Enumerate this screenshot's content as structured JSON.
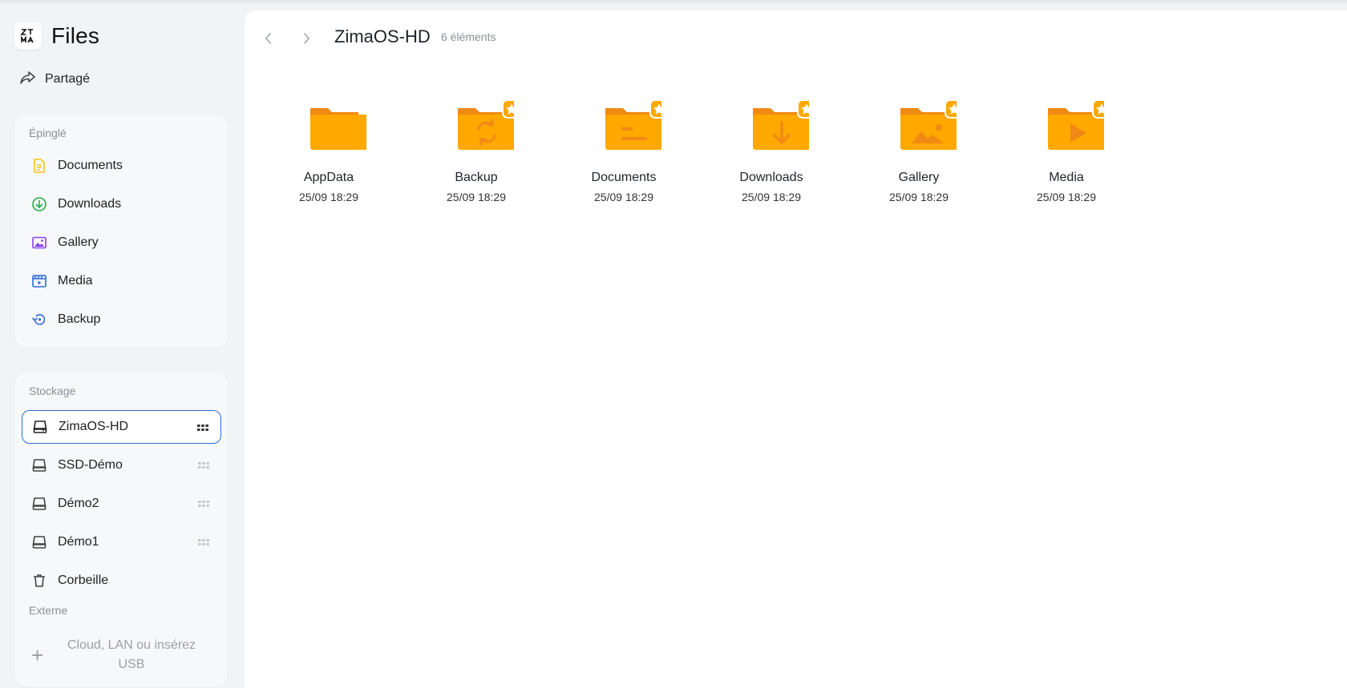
{
  "app": {
    "title": "Files",
    "logo_text": "ZT MA"
  },
  "sidebar": {
    "shared_label": "Partagé",
    "pinned_title": "Épinglé",
    "pinned": [
      {
        "label": "Documents",
        "icon": "document-icon",
        "color": "#f5c518"
      },
      {
        "label": "Downloads",
        "icon": "download-circle-icon",
        "color": "#22b04b"
      },
      {
        "label": "Gallery",
        "icon": "image-icon",
        "color": "#8a3ffc"
      },
      {
        "label": "Media",
        "icon": "video-clapper-icon",
        "color": "#2e6bdc"
      },
      {
        "label": "Backup",
        "icon": "backup-icon",
        "color": "#2e6bdc"
      }
    ],
    "storage_title": "Stockage",
    "storage": [
      {
        "label": "ZimaOS-HD",
        "active": true
      },
      {
        "label": "SSD-Démo",
        "active": false
      },
      {
        "label": "Démo2",
        "active": false
      },
      {
        "label": "Démo1",
        "active": false
      }
    ],
    "trash_label": "Corbeille",
    "external_title": "Externe",
    "external_add_label": "Cloud, LAN ou insérez USB"
  },
  "main": {
    "title": "ZimaOS-HD",
    "count": "6 éléments",
    "folders": [
      {
        "name": "AppData",
        "date": "25/09 18:29",
        "glyph": "none",
        "starred": false
      },
      {
        "name": "Backup",
        "date": "25/09 18:29",
        "glyph": "sync",
        "starred": true
      },
      {
        "name": "Documents",
        "date": "25/09 18:29",
        "glyph": "doc",
        "starred": true
      },
      {
        "name": "Downloads",
        "date": "25/09 18:29",
        "glyph": "download",
        "starred": true
      },
      {
        "name": "Gallery",
        "date": "25/09 18:29",
        "glyph": "image",
        "starred": true
      },
      {
        "name": "Media",
        "date": "25/09 18:29",
        "glyph": "play",
        "starred": true
      }
    ]
  },
  "colors": {
    "accent": "#2e6bdc",
    "folder": "#ffa800",
    "folder_dark": "#f08a14"
  }
}
